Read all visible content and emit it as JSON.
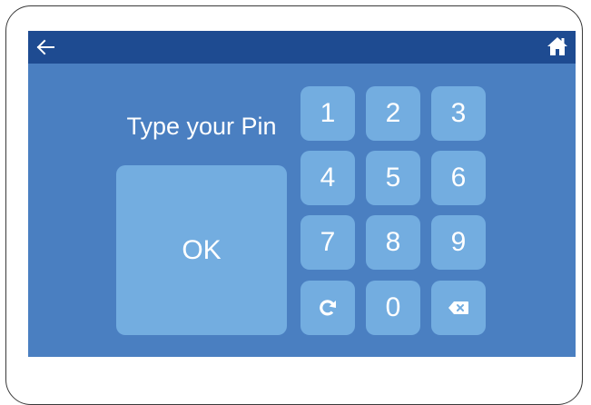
{
  "prompt": {
    "text": "Type your Pin"
  },
  "ok_button": {
    "label": "OK"
  },
  "keypad": {
    "keys": [
      "1",
      "2",
      "3",
      "4",
      "5",
      "6",
      "7",
      "8",
      "9",
      "0"
    ]
  },
  "icons": {
    "back": "arrow-left-icon",
    "home": "home-icon",
    "refresh": "refresh-icon",
    "backspace": "backspace-icon"
  },
  "colors": {
    "topbar": "#1e4b91",
    "screen": "#4a7fc1",
    "button": "#73ade0",
    "text": "#ffffff"
  }
}
